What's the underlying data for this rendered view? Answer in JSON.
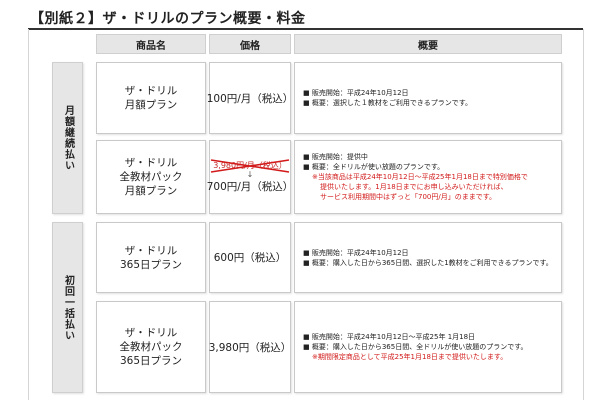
{
  "title": "【別紙２】ザ・ドリルのプラン概要・料金",
  "headers": {
    "product": "商品名",
    "price": "価格",
    "overview": "概要"
  },
  "groups": {
    "monthly": "月額継続払い",
    "onetime": "初回一括払い"
  },
  "rows": [
    {
      "name": [
        "ザ・ドリル",
        "月額プラン"
      ],
      "price": "100円/月（税込）",
      "desc": [
        {
          "text": "■ 販売開始：平成24年10月12日",
          "red": false,
          "indent": 0
        },
        {
          "text": "■ 概要：選択した１教材をご利用できるプランです。",
          "red": false,
          "indent": 0
        }
      ]
    },
    {
      "name": [
        "ザ・ドリル",
        "全教材パック",
        "月額プラン"
      ],
      "price_old": "3,980円/月（税込）",
      "price": "700円/月（税込）",
      "desc": [
        {
          "text": "■ 販売開始：提供中",
          "red": false,
          "indent": 0
        },
        {
          "text": "■ 概要：全ドリルが使い放題のプランです。",
          "red": false,
          "indent": 0
        },
        {
          "text": "※当該商品は平成24年10月12日～平成25年1月18日まで特別価格で",
          "red": true,
          "indent": 1
        },
        {
          "text": "提供いたします。1月18日までにお申し込みいただければ、",
          "red": true,
          "indent": 2
        },
        {
          "text": "サービス利用期間中はずっと「700円/月」のままです。",
          "red": true,
          "indent": 2
        }
      ]
    },
    {
      "name": [
        "ザ・ドリル",
        "365日プラン"
      ],
      "price": "600円（税込）",
      "desc": [
        {
          "text": "■ 販売開始：平成24年10月12日",
          "red": false,
          "indent": 0
        },
        {
          "text": "■ 概要：購入した日から365日間、選択した1教材をご利用できるプランです。",
          "red": false,
          "indent": 0
        }
      ]
    },
    {
      "name": [
        "ザ・ドリル",
        "全教材パック",
        "365日プラン"
      ],
      "price": "3,980円（税込）",
      "desc": [
        {
          "text": "■ 販売開始：平成24年10月12日～平成25年 1月18日",
          "red": false,
          "indent": 0
        },
        {
          "text": "■ 概要：購入した日から365日間、全ドリルが使い放題のプランです。",
          "red": false,
          "indent": 0
        },
        {
          "text": "※期間限定商品として平成25年1月18日まで提供いたします。",
          "red": true,
          "indent": 1
        }
      ]
    }
  ]
}
